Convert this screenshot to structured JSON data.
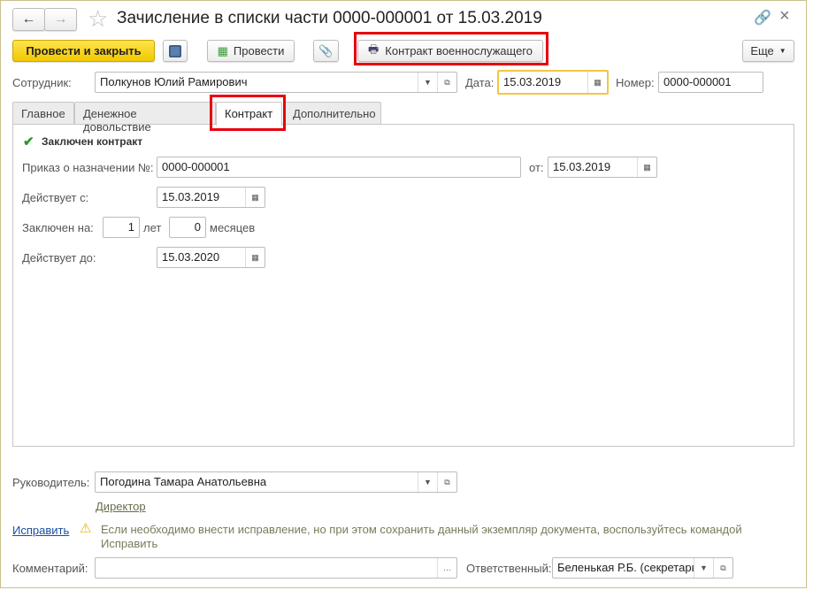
{
  "header": {
    "title": "Зачисление в списки части 0000-000001 от 15.03.2019"
  },
  "toolbar": {
    "post_close": "Провести и закрыть",
    "post": "Провести",
    "print_contract": "Контракт военнослужащего",
    "more": "Еще"
  },
  "fields": {
    "employee_label": "Сотрудник:",
    "employee": "Полкунов Юлий Рамирович",
    "date_label": "Дата:",
    "date": "15.03.2019",
    "number_label": "Номер:",
    "number": "0000-000001"
  },
  "tabs": [
    "Главное",
    "Денежное довольствие",
    "Контракт",
    "Дополнительно"
  ],
  "contract": {
    "concluded_label": "Заключен контракт",
    "order_label": "Приказ о назначении №:",
    "order": "0000-000001",
    "from_label": "от:",
    "order_date": "15.03.2019",
    "valid_from_label": "Действует с:",
    "valid_from": "15.03.2019",
    "term_label": "Заключен на:",
    "years": "1",
    "years_label": "лет",
    "months": "0",
    "months_label": "месяцев",
    "valid_to_label": "Действует до:",
    "valid_to": "15.03.2020"
  },
  "footer": {
    "head_label": "Руководитель:",
    "head": "Погодина Тамара Анатольевна",
    "head_position": "Директор",
    "fix_link": "Исправить",
    "warning": "Если необходимо внести исправление, но при этом сохранить данный экземпляр документа, воспользуйтесь командой Исправить",
    "comment_label": "Комментарий:",
    "comment": "",
    "responsible_label": "Ответственный:",
    "responsible": "Беленькая Р.Б. (секретарь)"
  }
}
